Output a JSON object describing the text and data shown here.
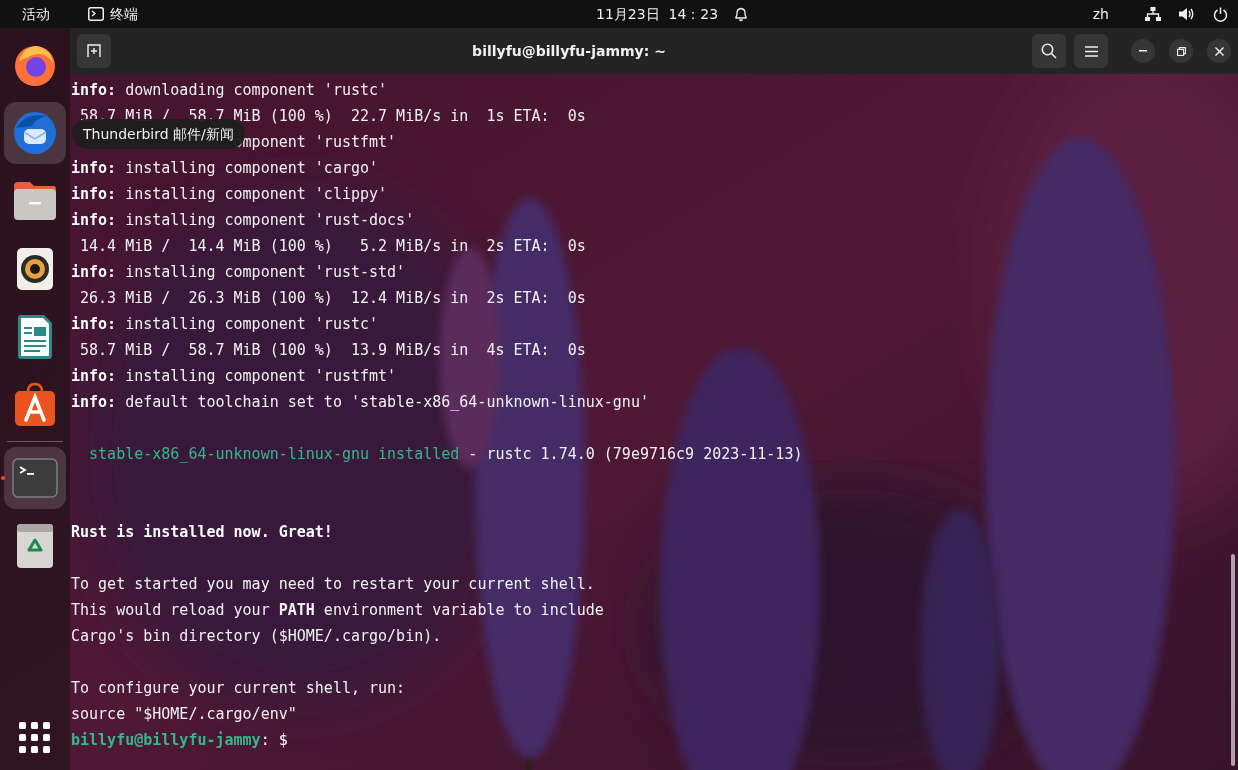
{
  "top_bar": {
    "activities": "活动",
    "app_menu": "终端",
    "clock": "11月23日  14：23",
    "input_method": "zh"
  },
  "dock": {
    "items": [
      {
        "kind": "firefox",
        "selected": false,
        "running": false
      },
      {
        "kind": "thunderbird",
        "selected": true,
        "running": false
      },
      {
        "kind": "files",
        "selected": false,
        "running": false
      },
      {
        "kind": "rhythmbox",
        "selected": false,
        "running": false
      },
      {
        "kind": "writer",
        "selected": false,
        "running": false
      },
      {
        "kind": "appcenter",
        "selected": false,
        "running": false
      },
      {
        "kind": "separator"
      },
      {
        "kind": "terminal",
        "selected": true,
        "running": true
      },
      {
        "kind": "trash",
        "selected": false,
        "running": false
      }
    ],
    "tooltip": "Thunderbird 邮件/新闻"
  },
  "terminal": {
    "title": "billyfu@billyfu-jammy: ~",
    "lines": [
      {
        "kind": "info",
        "label": "info:",
        "text": "downloading component 'rustc'"
      },
      {
        "kind": "plain",
        "text": " 58.7 MiB /  58.7 MiB (100 %)  22.7 MiB/s in  1s ETA:  0s"
      },
      {
        "kind": "covered",
        "text": "omponent 'rustfmt'"
      },
      {
        "kind": "info",
        "label": "info:",
        "text": "installing component 'cargo'"
      },
      {
        "kind": "info",
        "label": "info:",
        "text": "installing component 'clippy'"
      },
      {
        "kind": "info",
        "label": "info:",
        "text": "installing component 'rust-docs'"
      },
      {
        "kind": "plain",
        "text": " 14.4 MiB /  14.4 MiB (100 %)   5.2 MiB/s in  2s ETA:  0s"
      },
      {
        "kind": "info",
        "label": "info:",
        "text": "installing component 'rust-std'"
      },
      {
        "kind": "plain",
        "text": " 26.3 MiB /  26.3 MiB (100 %)  12.4 MiB/s in  2s ETA:  0s"
      },
      {
        "kind": "info",
        "label": "info:",
        "text": "installing component 'rustc'"
      },
      {
        "kind": "plain",
        "text": " 58.7 MiB /  58.7 MiB (100 %)  13.9 MiB/s in  4s ETA:  0s"
      },
      {
        "kind": "info",
        "label": "info:",
        "text": "installing component 'rustfmt'"
      },
      {
        "kind": "info",
        "label": "info:",
        "text": "default toolchain set to 'stable-x86_64-unknown-linux-gnu'"
      },
      {
        "kind": "blank"
      },
      {
        "kind": "toolchain",
        "name": "stable-x86_64-unknown-linux-gnu installed",
        "text": "- rustc 1.74.0 (79e9716c9 2023-11-13)"
      },
      {
        "kind": "blank"
      },
      {
        "kind": "blank"
      },
      {
        "kind": "bold",
        "text": "Rust is installed now. Great!"
      },
      {
        "kind": "blank"
      },
      {
        "kind": "plain",
        "text": "To get started you may need to restart your current shell."
      },
      {
        "kind": "plain",
        "text": "This would reload your **PATH** environment variable to include"
      },
      {
        "kind": "plain",
        "text": "Cargo's bin directory ($HOME/.cargo/bin)."
      },
      {
        "kind": "blank"
      },
      {
        "kind": "plain",
        "text": "To configure your current shell, run:"
      },
      {
        "kind": "plain",
        "text": "source \"$HOME/.cargo/env\""
      },
      {
        "kind": "prompt",
        "user": "billyfu@billyfu-jammy",
        "text": ": $"
      }
    ]
  }
}
